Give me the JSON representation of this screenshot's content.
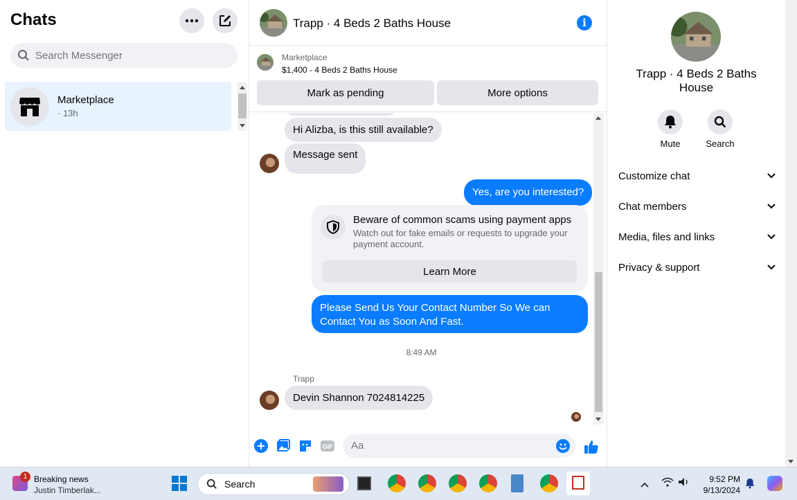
{
  "sidebar": {
    "title": "Chats",
    "search_placeholder": "Search Messenger",
    "chats": [
      {
        "name": "Marketplace",
        "time": "· 13h"
      }
    ]
  },
  "conversation": {
    "title": "Trapp · 4 Beds 2 Baths House",
    "marketplace_label": "Marketplace",
    "listing": "$1,400 - 4 Beds 2 Baths House",
    "mark_pending": "Mark as pending",
    "more_options": "More options",
    "messages": [
      {
        "from": "them",
        "text": "Hi Alizba, is this still available?"
      },
      {
        "from": "them",
        "text": "Message sent"
      },
      {
        "from": "me",
        "text": "Yes, are you interested?"
      },
      {
        "from": "me",
        "text": "Please Send Us Your Contact Number So We can Contact You as Soon And Fast."
      },
      {
        "from": "them",
        "text": "Devin Shannon 7024814225"
      }
    ],
    "warning": {
      "title": "Beware of common scams using payment apps",
      "text": "Watch out for fake emails or requests to upgrade your payment account.",
      "button": "Learn More"
    },
    "timestamp": "8:49 AM",
    "sender_name": "Trapp",
    "composer_placeholder": "Aa"
  },
  "info_panel": {
    "title": "Trapp · 4 Beds 2 Baths House",
    "actions": [
      "Mute",
      "Search"
    ],
    "sections": [
      "Customize chat",
      "Chat members",
      "Media, files and links",
      "Privacy & support"
    ]
  },
  "taskbar": {
    "news_title": "Breaking news",
    "news_sub": "Justin Timberlak...",
    "notification_count": "1",
    "search_label": "Search",
    "time": "9:52 PM",
    "date": "9/13/2024"
  },
  "colors": {
    "accent": "#0a7cff",
    "bubble_in": "#e4e6eb",
    "selected": "#e7f3ff"
  }
}
